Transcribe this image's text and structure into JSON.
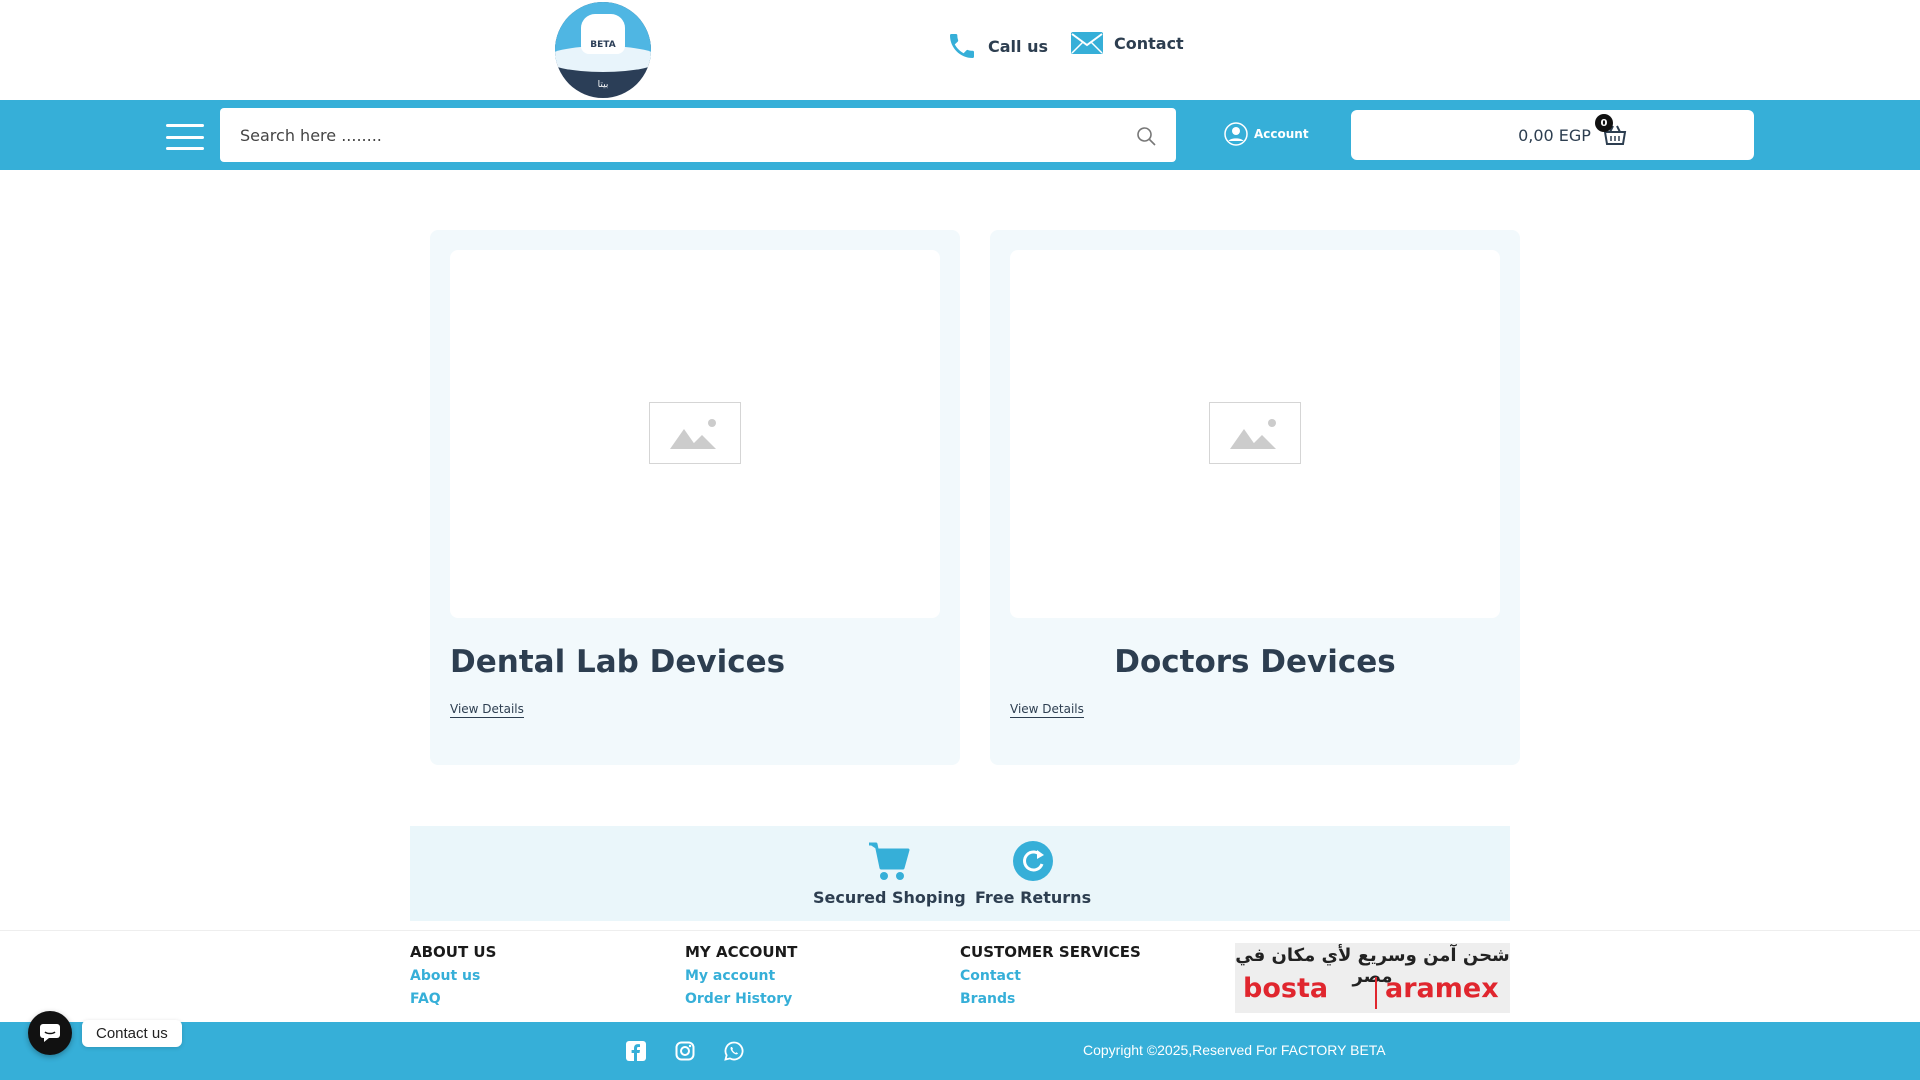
{
  "header": {
    "logo_text": "BETA",
    "logo_text_ar": "بيتا",
    "call_label": "Call us",
    "contact_label": "Contact"
  },
  "navbar": {
    "search_placeholder": "Search here ........",
    "account_label": "Account",
    "cart_total": "0,00 EGP",
    "cart_count": "0"
  },
  "categories": [
    {
      "title": "Dental Lab Devices",
      "link_label": "View Details"
    },
    {
      "title": "Doctors Devices",
      "link_label": "View Details"
    }
  ],
  "features": [
    {
      "label": "Secured Shoping",
      "icon": "cart-icon"
    },
    {
      "label": "Free Returns",
      "icon": "refresh-icon"
    }
  ],
  "footer": {
    "about": {
      "heading": "ABOUT US",
      "links": [
        "About us",
        "FAQ"
      ]
    },
    "account": {
      "heading": "MY ACCOUNT",
      "links": [
        "My account",
        "Order History"
      ]
    },
    "services": {
      "heading": "CUSTOMER SERVICES",
      "links": [
        "Contact",
        "Brands"
      ]
    },
    "shipping_text_ar": "شحن آمن وسريع لأي مكان في مصر",
    "shipping_brand_1": "bosta",
    "shipping_brand_2": "aramex",
    "copyright": "Copyright ©2025,Reserved For FACTORY BETA"
  },
  "chat": {
    "label": "Contact us"
  },
  "colors": {
    "accent": "#36afd8",
    "text": "#2d3e50",
    "card_bg": "#f2f9fc"
  }
}
